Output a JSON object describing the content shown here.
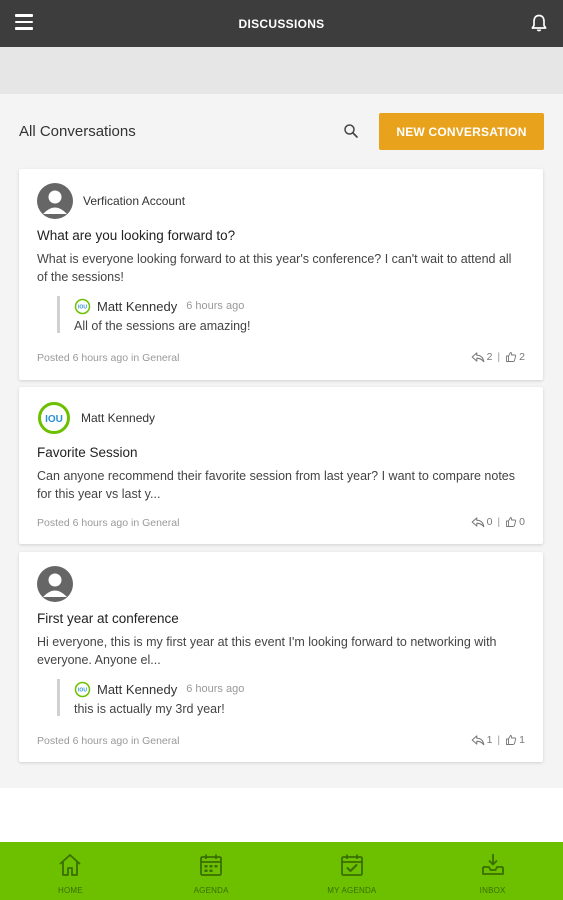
{
  "header": {
    "title": "DISCUSSIONS",
    "menu_icon": "hamburger-menu-icon",
    "bell_icon": "bell-icon"
  },
  "toolbar": {
    "title": "All Conversations",
    "search_icon": "search-icon",
    "new_conversation_label": "NEW CONVERSATION"
  },
  "colors": {
    "topbar": "#3d3d3d",
    "accent": "#e8a21c",
    "bottom_nav": "#6cc000"
  },
  "posts": [
    {
      "author": "Verfication Account",
      "avatar": "default-user-avatar",
      "title": "What are you looking forward to?",
      "body": "What is everyone looking forward to at this year's conference? I can't wait to attend all of the sessions!",
      "reply": {
        "author": "Matt Kennedy",
        "time": "6 hours ago",
        "text": "All of the sessions are amazing!"
      },
      "meta": "Posted 6 hours ago in General",
      "replies": "2",
      "likes": "2"
    },
    {
      "author": "Matt Kennedy",
      "avatar": "iou-logo-avatar",
      "title": "Favorite Session",
      "body": "Can anyone recommend their favorite session from last year? I want to compare notes for this year vs last y...",
      "meta": "Posted 6 hours ago in General",
      "replies": "0",
      "likes": "0"
    },
    {
      "author": "",
      "avatar": "default-user-avatar",
      "title": "First year at conference",
      "body": "Hi everyone, this is my first year at this event I'm looking forward to networking with everyone. Anyone el...",
      "reply": {
        "author": "Matt Kennedy",
        "time": "6 hours ago",
        "text": "this is actually my 3rd year!"
      },
      "meta": "Posted 6 hours ago in General",
      "replies": "1",
      "likes": "1"
    }
  ],
  "bottom_nav": [
    {
      "label": "HOME",
      "icon": "home-icon"
    },
    {
      "label": "AGENDA",
      "icon": "calendar-icon"
    },
    {
      "label": "MY AGENDA",
      "icon": "calendar-check-icon"
    },
    {
      "label": "INBOX",
      "icon": "inbox-icon"
    }
  ]
}
